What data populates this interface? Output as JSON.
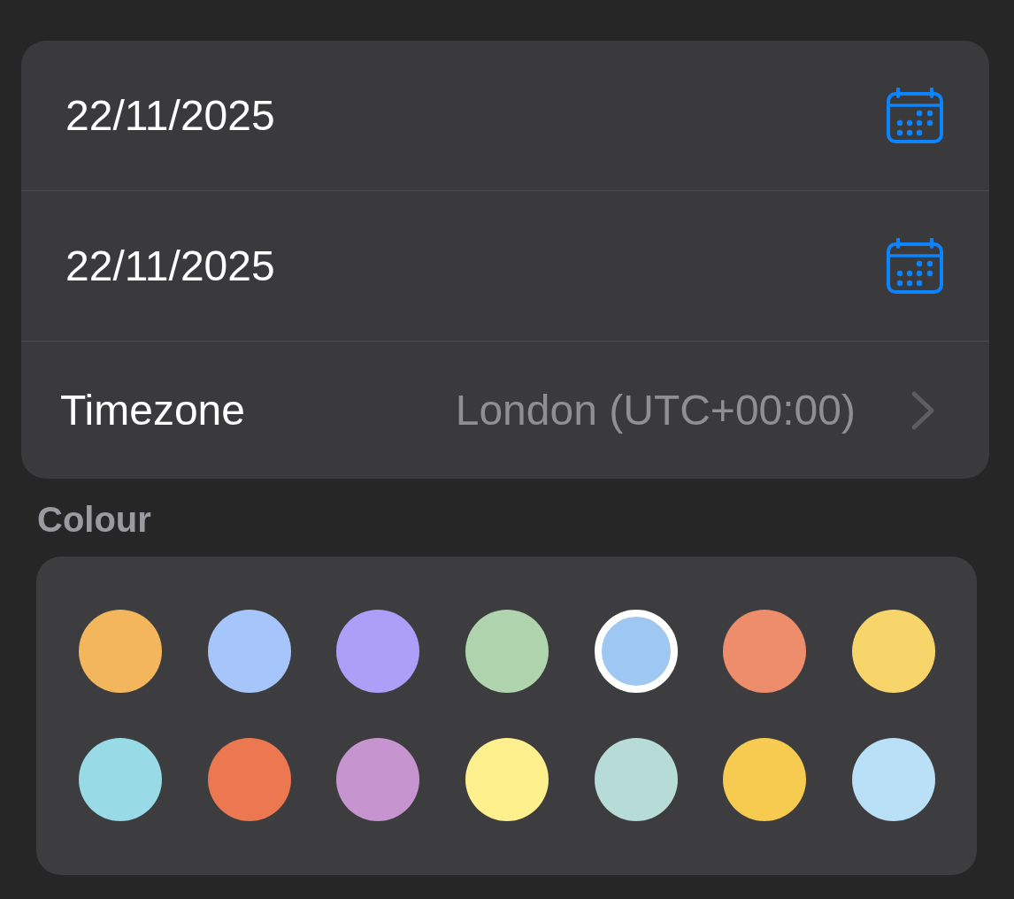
{
  "dates": [
    {
      "value": "22/11/2025"
    },
    {
      "value": "22/11/2025"
    }
  ],
  "timezone": {
    "label": "Timezone",
    "value": "London (UTC+00:00)"
  },
  "colour": {
    "label": "Colour",
    "swatches": [
      {
        "color": "#f3b65c",
        "selected": false
      },
      {
        "color": "#a6c5fa",
        "selected": false
      },
      {
        "color": "#ad9ff8",
        "selected": false
      },
      {
        "color": "#b0d4ae",
        "selected": false
      },
      {
        "color": "#9ec8f2",
        "selected": true
      },
      {
        "color": "#ee8d6c",
        "selected": false
      },
      {
        "color": "#f8d56a",
        "selected": false
      },
      {
        "color": "#98dbe6",
        "selected": false
      },
      {
        "color": "#ec7851",
        "selected": false
      },
      {
        "color": "#c695d0",
        "selected": false
      },
      {
        "color": "#fdf08d",
        "selected": false
      },
      {
        "color": "#b7dcd8",
        "selected": false
      },
      {
        "color": "#f6cb50",
        "selected": false
      },
      {
        "color": "#b9e0f7",
        "selected": false
      }
    ]
  }
}
